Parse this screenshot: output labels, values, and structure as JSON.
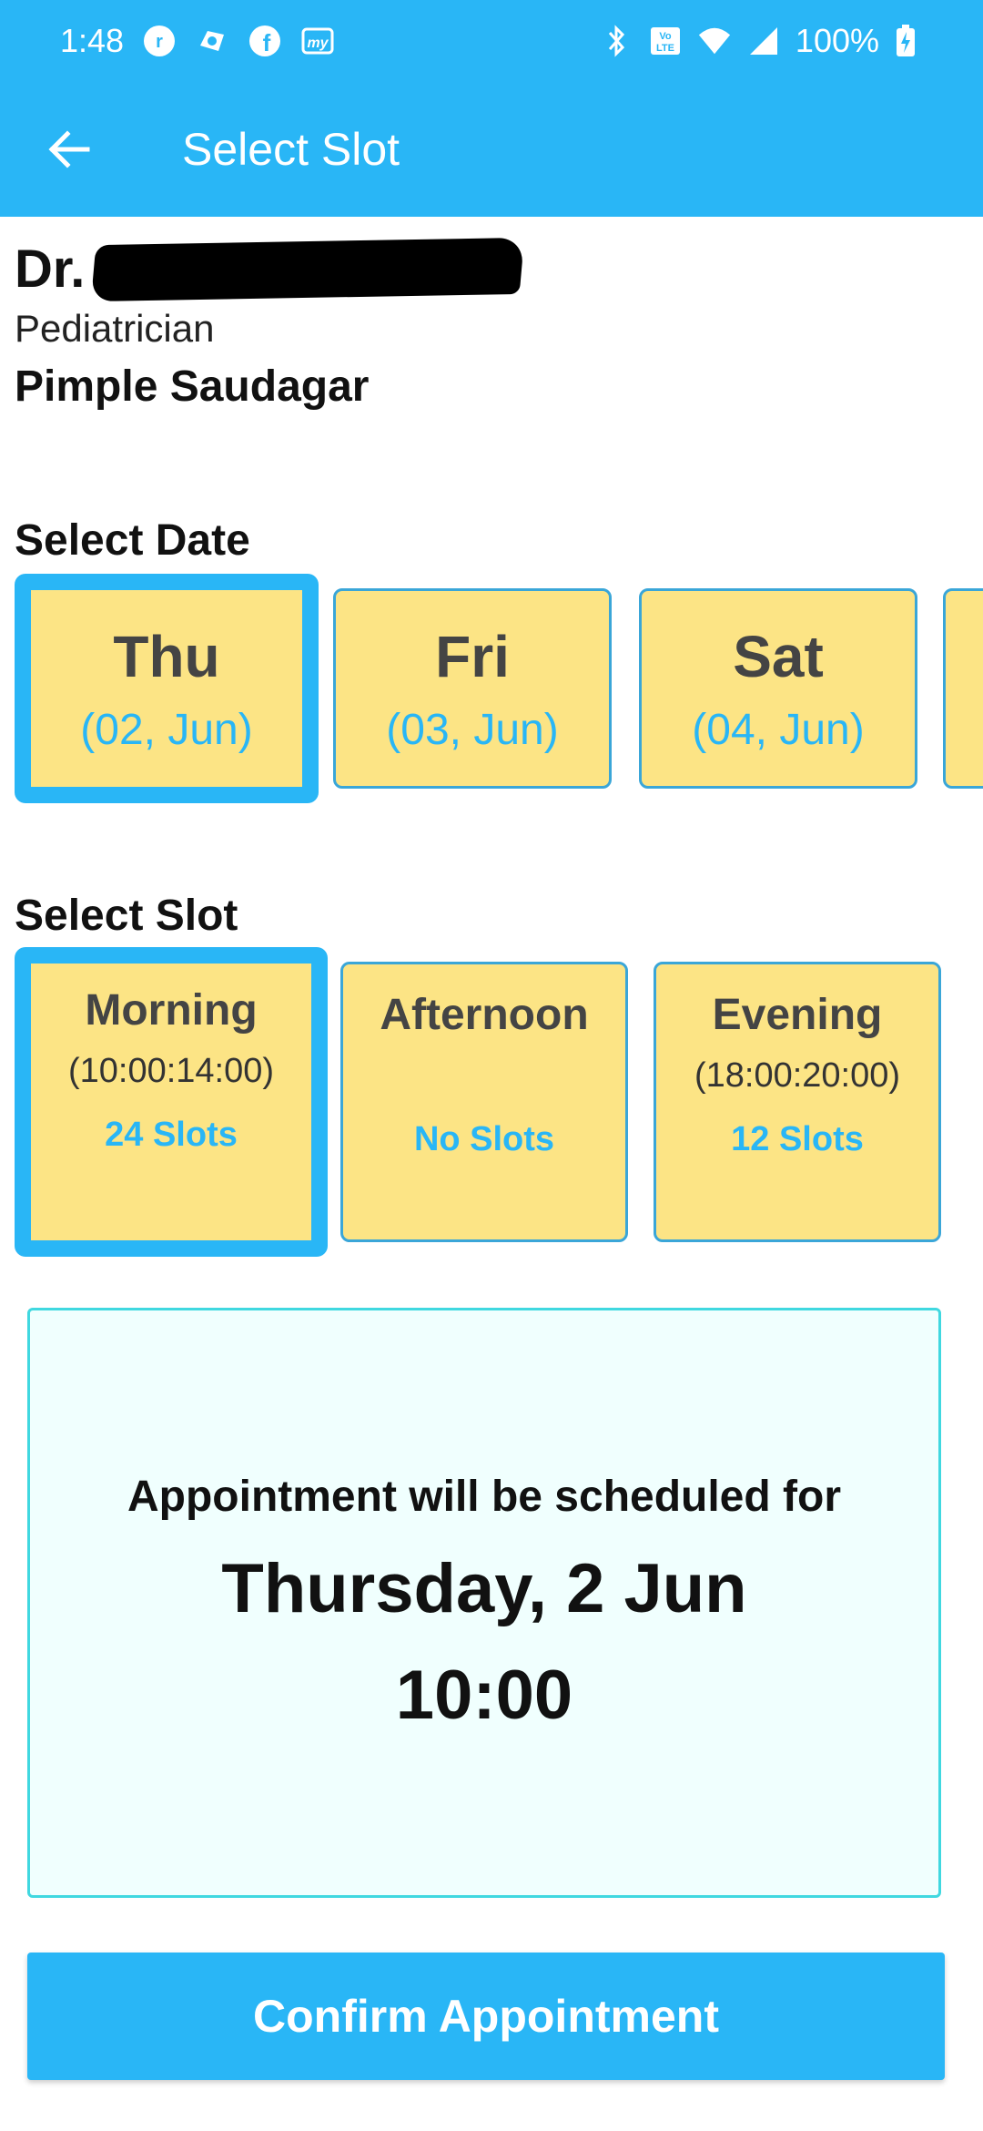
{
  "status_bar": {
    "time": "1:48",
    "battery": "100%",
    "left_icons": [
      "r-app-icon",
      "cloud-app-icon",
      "facebook-icon",
      "my-app-icon"
    ],
    "right_icons": [
      "bluetooth-icon",
      "volte-icon",
      "wifi-icon",
      "signal-icon",
      "battery-charging-icon"
    ]
  },
  "app_bar": {
    "title": "Select Slot",
    "back_icon": "arrow-left-icon",
    "color": "#29b6f6"
  },
  "doctor": {
    "prefix": "Dr.",
    "specialty": "Pediatrician",
    "location": "Pimple Saudagar"
  },
  "date_section": {
    "label": "Select Date",
    "dates": [
      {
        "day": "Thu",
        "date": "(02, Jun)",
        "selected": true
      },
      {
        "day": "Fri",
        "date": "(03, Jun)",
        "selected": false
      },
      {
        "day": "Sat",
        "date": "(04, Jun)",
        "selected": false
      }
    ]
  },
  "slot_section": {
    "label": "Select Slot",
    "slots": [
      {
        "name": "Morning",
        "time": "(10:00:14:00)",
        "count": "24 Slots",
        "selected": true
      },
      {
        "name": "Afternoon",
        "time": "",
        "count": "No Slots",
        "selected": false
      },
      {
        "name": "Evening",
        "time": "(18:00:20:00)",
        "count": "12 Slots",
        "selected": false
      }
    ]
  },
  "summary": {
    "lead": "Appointment will be scheduled for",
    "date": "Thursday, 2 Jun",
    "time": "10:00"
  },
  "confirm_button": {
    "label": "Confirm Appointment"
  },
  "colors": {
    "accent": "#29b6f6",
    "card": "#fce485",
    "summary_bg": "#f0fffe",
    "summary_border": "#40d8e0"
  }
}
